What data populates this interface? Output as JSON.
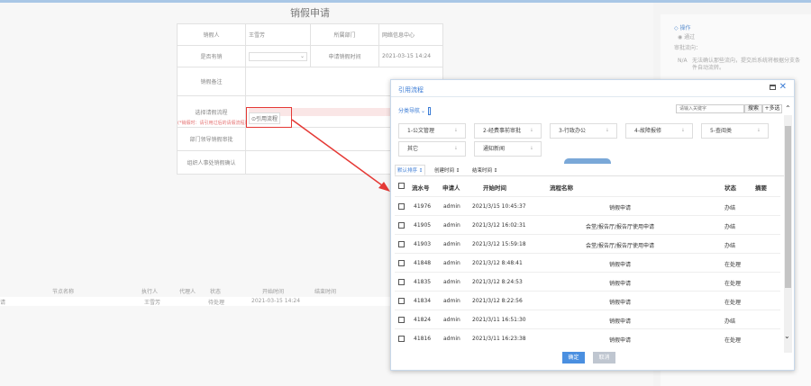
{
  "form": {
    "title": "销假申请",
    "applicant_label": "销假人",
    "applicant_value": "王雪芳",
    "dept_label": "所属部门",
    "dept_value": "网络信息中心",
    "type_label": "是否有销",
    "time_label": "申请销假时间",
    "time_value": "2021-03-15 14:24",
    "note_label": "销假备注",
    "process_label": "选择请假流程",
    "ref_button": "引用流程",
    "warning": "(*销假时：请引用过后的请假流程）",
    "dept_approve_label": "部门领导销假审批",
    "hr_confirm_label": "组织人事处销假确认"
  },
  "bottom_table": {
    "headers": [
      "节点名称",
      "执行人",
      "代理人",
      "状态",
      "开始时间",
      "结束时间"
    ],
    "row": {
      "node": "请",
      "executor": "王雪芳",
      "status": "待处理",
      "start": "2021-03-15 14:24"
    }
  },
  "right_panel": {
    "title": "◇ 操作",
    "option": "◉ 通过",
    "routing_label": "审批流向：",
    "na": "N/A",
    "hint": "无法确认那些流向，提交后系统将根据分支条件自动流转。"
  },
  "dialog": {
    "title": "引用流程",
    "category_nav": "分类导航",
    "search_placeholder": "请输入关键字",
    "search_button": "搜索",
    "more_button": "+多选",
    "categories": [
      "1-公文管理",
      "2-经费事前审批",
      "3-行政办公",
      "4-故障报修",
      "5-查阅类",
      "其它",
      "通知新闻"
    ],
    "sort_tabs": [
      "默认排序 ↕",
      "创建时间 ↕",
      "结束时间 ↕"
    ],
    "columns": {
      "id": "流水号",
      "applicant": "申请人",
      "start": "开始时间",
      "name": "流程名称",
      "status": "状态",
      "summary": "摘要"
    },
    "rows": [
      {
        "id": "41976",
        "applicant": "admin",
        "start": "2021/3/15 10:45:37",
        "name": "销假申请",
        "status": "办结"
      },
      {
        "id": "41905",
        "applicant": "admin",
        "start": "2021/3/12 16:02:31",
        "name": "会堂/报告厅/报告厅使用申请",
        "status": "办结"
      },
      {
        "id": "41903",
        "applicant": "admin",
        "start": "2021/3/12 15:59:18",
        "name": "会堂/报告厅/报告厅使用申请",
        "status": "办结"
      },
      {
        "id": "41848",
        "applicant": "admin",
        "start": "2021/3/12 8:48:41",
        "name": "销假申请",
        "status": "在处理"
      },
      {
        "id": "41835",
        "applicant": "admin",
        "start": "2021/3/12 8:24:53",
        "name": "销假申请",
        "status": "在处理"
      },
      {
        "id": "41834",
        "applicant": "admin",
        "start": "2021/3/12 8:22:56",
        "name": "销假申请",
        "status": "在处理"
      },
      {
        "id": "41824",
        "applicant": "admin",
        "start": "2021/3/11 16:51:30",
        "name": "销假申请",
        "status": "办结"
      },
      {
        "id": "41816",
        "applicant": "admin",
        "start": "2021/3/11 16:23:38",
        "name": "销假申请",
        "status": "在处理"
      }
    ],
    "ok_button": "确定",
    "cancel_button": "取消"
  },
  "colors": {
    "accent": "#3a7bd5",
    "highlight": "#e53935"
  }
}
